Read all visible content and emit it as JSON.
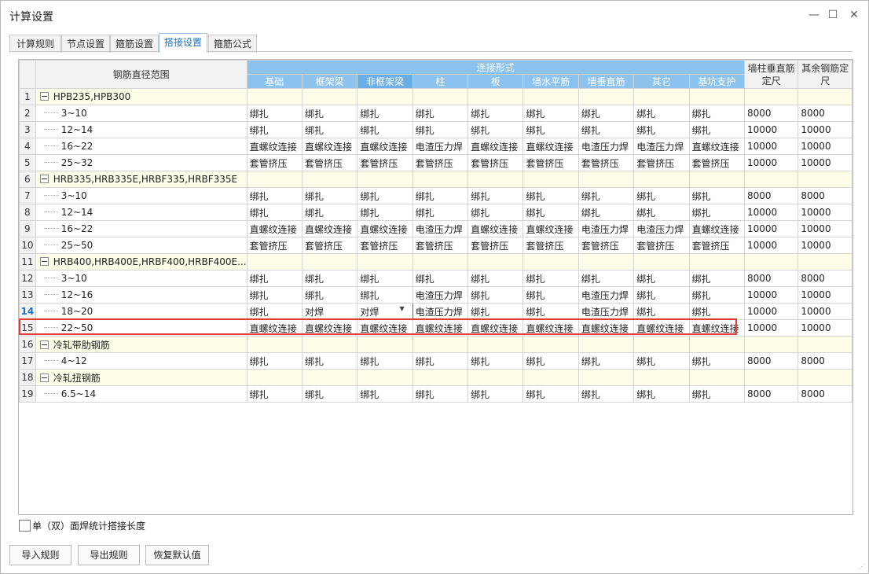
{
  "window": {
    "title": "计算设置",
    "min_icon": "minimize-icon",
    "max_icon": "maximize-icon",
    "close_icon": "close-icon"
  },
  "tabs": [
    {
      "label": "计算规则",
      "active": false
    },
    {
      "label": "节点设置",
      "active": false
    },
    {
      "label": "箍筋设置",
      "active": false
    },
    {
      "label": "搭接设置",
      "active": true
    },
    {
      "label": "箍筋公式",
      "active": false
    }
  ],
  "grid": {
    "header_name": "钢筋直径范围",
    "header_group": "连接形式",
    "columns": [
      "基础",
      "框架梁",
      "非框架梁",
      "柱",
      "板",
      "墙水平筋",
      "墙垂直筋",
      "其它",
      "基坑支护"
    ],
    "col_wall_vertical": "墙柱垂直筋定尺",
    "col_other_length": "其余钢筋定尺",
    "rows": [
      {
        "num": "1",
        "group": true,
        "name": "HPB235,HPB300"
      },
      {
        "num": "2",
        "name": "3~10",
        "values": [
          "绑扎",
          "绑扎",
          "绑扎",
          "绑扎",
          "绑扎",
          "绑扎",
          "绑扎",
          "绑扎",
          "绑扎"
        ],
        "len1": "8000",
        "len2": "8000"
      },
      {
        "num": "3",
        "name": "12~14",
        "values": [
          "绑扎",
          "绑扎",
          "绑扎",
          "绑扎",
          "绑扎",
          "绑扎",
          "绑扎",
          "绑扎",
          "绑扎"
        ],
        "len1": "10000",
        "len2": "10000"
      },
      {
        "num": "4",
        "name": "16~22",
        "values": [
          "直螺纹连接",
          "直螺纹连接",
          "直螺纹连接",
          "电渣压力焊",
          "直螺纹连接",
          "直螺纹连接",
          "电渣压力焊",
          "电渣压力焊",
          "直螺纹连接"
        ],
        "len1": "10000",
        "len2": "10000"
      },
      {
        "num": "5",
        "name": "25~32",
        "values": [
          "套管挤压",
          "套管挤压",
          "套管挤压",
          "套管挤压",
          "套管挤压",
          "套管挤压",
          "套管挤压",
          "套管挤压",
          "套管挤压"
        ],
        "len1": "10000",
        "len2": "10000"
      },
      {
        "num": "6",
        "group": true,
        "name": "HRB335,HRB335E,HRBF335,HRBF335E"
      },
      {
        "num": "7",
        "name": "3~10",
        "values": [
          "绑扎",
          "绑扎",
          "绑扎",
          "绑扎",
          "绑扎",
          "绑扎",
          "绑扎",
          "绑扎",
          "绑扎"
        ],
        "len1": "8000",
        "len2": "8000"
      },
      {
        "num": "8",
        "name": "12~14",
        "values": [
          "绑扎",
          "绑扎",
          "绑扎",
          "绑扎",
          "绑扎",
          "绑扎",
          "绑扎",
          "绑扎",
          "绑扎"
        ],
        "len1": "10000",
        "len2": "10000"
      },
      {
        "num": "9",
        "name": "16~22",
        "values": [
          "直螺纹连接",
          "直螺纹连接",
          "直螺纹连接",
          "电渣压力焊",
          "直螺纹连接",
          "直螺纹连接",
          "电渣压力焊",
          "电渣压力焊",
          "直螺纹连接"
        ],
        "len1": "10000",
        "len2": "10000"
      },
      {
        "num": "10",
        "name": "25~50",
        "values": [
          "套管挤压",
          "套管挤压",
          "套管挤压",
          "套管挤压",
          "套管挤压",
          "套管挤压",
          "套管挤压",
          "套管挤压",
          "套管挤压"
        ],
        "len1": "10000",
        "len2": "10000"
      },
      {
        "num": "11",
        "group": true,
        "name": "HRB400,HRB400E,HRBF400,HRBF400E..."
      },
      {
        "num": "12",
        "name": "3~10",
        "values": [
          "绑扎",
          "绑扎",
          "绑扎",
          "绑扎",
          "绑扎",
          "绑扎",
          "绑扎",
          "绑扎",
          "绑扎"
        ],
        "len1": "8000",
        "len2": "8000"
      },
      {
        "num": "13",
        "name": "12~16",
        "values": [
          "绑扎",
          "绑扎",
          "绑扎",
          "电渣压力焊",
          "绑扎",
          "绑扎",
          "电渣压力焊",
          "绑扎",
          "绑扎"
        ],
        "len1": "10000",
        "len2": "10000"
      },
      {
        "num": "14",
        "name": "18~20",
        "current": true,
        "values": [
          "绑扎",
          "对焊",
          "对焊",
          "电渣压力焊",
          "绑扎",
          "绑扎",
          "电渣压力焊",
          "绑扎",
          "绑扎"
        ],
        "len1": "10000",
        "len2": "10000"
      },
      {
        "num": "15",
        "name": "22~50",
        "values": [
          "直螺纹连接",
          "直螺纹连接",
          "直螺纹连接",
          "直螺纹连接",
          "直螺纹连接",
          "直螺纹连接",
          "直螺纹连接",
          "直螺纹连接",
          "直螺纹连接"
        ],
        "len1": "10000",
        "len2": "10000"
      },
      {
        "num": "16",
        "group": true,
        "name": "冷轧带肋钢筋"
      },
      {
        "num": "17",
        "name": "4~12",
        "values": [
          "绑扎",
          "绑扎",
          "绑扎",
          "绑扎",
          "绑扎",
          "绑扎",
          "绑扎",
          "绑扎",
          "绑扎"
        ],
        "len1": "8000",
        "len2": "8000"
      },
      {
        "num": "18",
        "group": true,
        "name": "冷轧扭钢筋"
      },
      {
        "num": "19",
        "name": "6.5~14",
        "values": [
          "绑扎",
          "绑扎",
          "绑扎",
          "绑扎",
          "绑扎",
          "绑扎",
          "绑扎",
          "绑扎",
          "绑扎"
        ],
        "len1": "8000",
        "len2": "8000"
      }
    ]
  },
  "checkbox_label": "单（双）面焊统计搭接长度",
  "buttons": {
    "import": "导入规则",
    "export": "导出规则",
    "restore": "恢复默认值"
  }
}
